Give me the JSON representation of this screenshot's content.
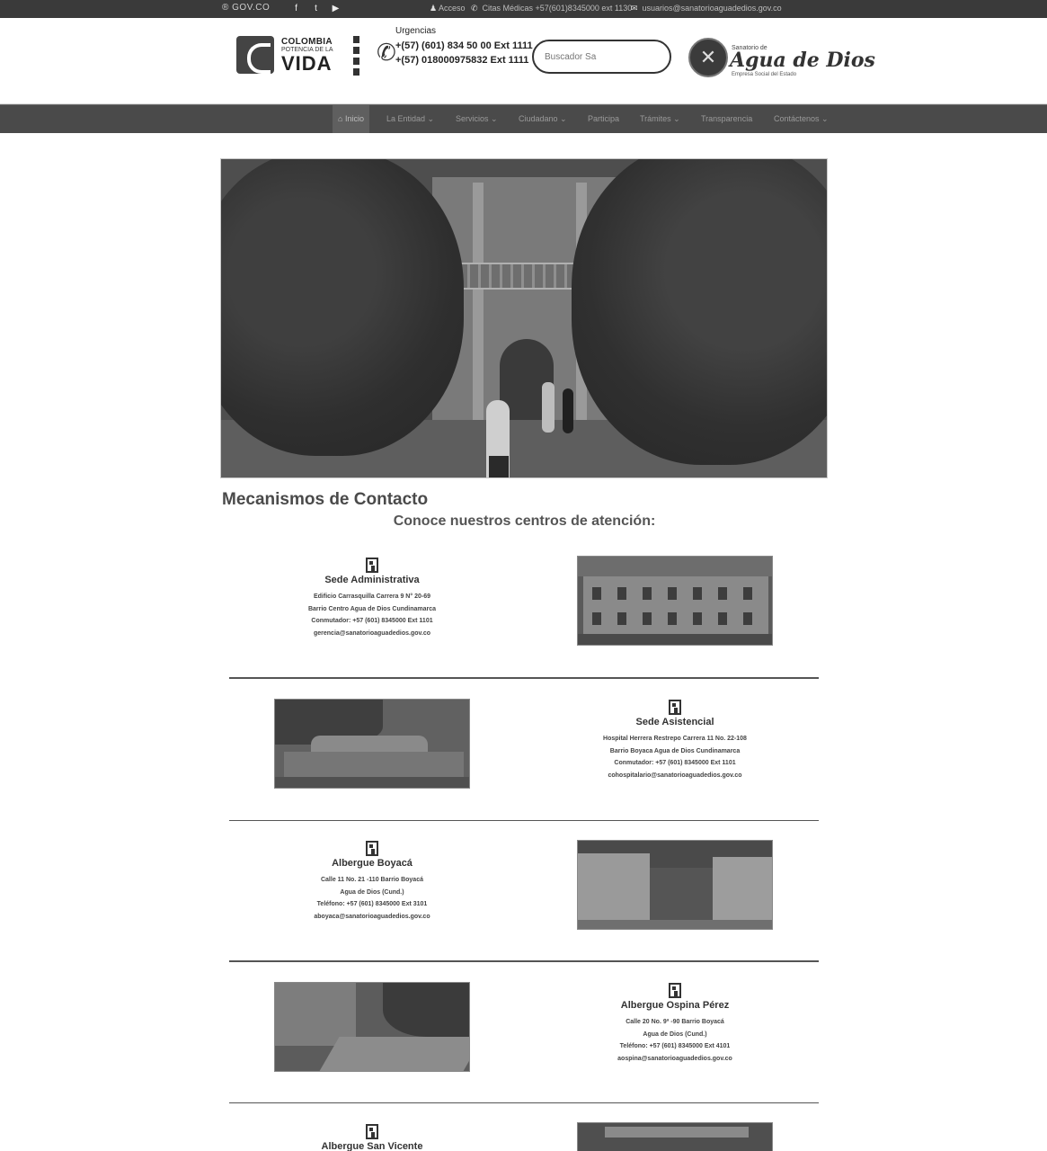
{
  "topbar": {
    "gov_label": "GOV.CO",
    "social": [
      "facebook-icon",
      "twitter-icon",
      "youtube-icon"
    ],
    "access_label": "Acceso",
    "appointments_label": "Citas Médicas +57(601)8345000 ext 1130",
    "email_label": "usuarios@sanatorioaguadedios.gov.co"
  },
  "header": {
    "logo_line1": "COLOMBIA",
    "logo_line2": "POTENCIA DE LA",
    "logo_line3": "VIDA",
    "urgencias_label": "Urgencias",
    "phone1": "+(57) (601) 834 50 00 Ext 1111",
    "phone2": "+(57) 018000975832 Ext 1111",
    "search_placeholder": "Buscador Sa",
    "brand_small": "Sanatorio de",
    "brand_name": "Agua de Dios",
    "brand_sub": "Empresa Social del Estado"
  },
  "nav": {
    "items": [
      {
        "label": "Inicio",
        "active": true
      },
      {
        "label": "La Entidad ⌄",
        "active": false
      },
      {
        "label": "Servicios ⌄",
        "active": false
      },
      {
        "label": "Ciudadano ⌄",
        "active": false
      },
      {
        "label": "Participa",
        "active": false
      },
      {
        "label": "Trámites ⌄",
        "active": false
      },
      {
        "label": "Transparencia",
        "active": false
      },
      {
        "label": "Contáctenos ⌄",
        "active": false
      }
    ]
  },
  "content": {
    "title": "Mecanismos de Contacto",
    "subtitle": "Conoce nuestros centros de atención:",
    "centers": [
      {
        "name": "Sede Administrativa",
        "lines": [
          "Edificio Carrasquilla Carrera 9 N° 20-69",
          "Barrio Centro Agua de Dios Cundinamarca",
          "Conmutador: +57 (601) 8345000 Ext 1101",
          "gerencia@sanatorioaguadedios.gov.co"
        ]
      },
      {
        "name": "Sede Asistencial",
        "lines": [
          "Hospital Herrera Restrepo Carrera 11 No. 22-108",
          "Barrio Boyaca Agua de Dios Cundinamarca",
          "Conmutador: +57 (601) 8345000 Ext 1101",
          "cohospitalario@sanatorioaguadedios.gov.co"
        ]
      },
      {
        "name": "Albergue Boyacá",
        "lines": [
          "Calle 11 No. 21 -110 Barrio Boyacá",
          "Agua de Dios (Cund.)",
          "Teléfono: +57 (601) 8345000 Ext 3101",
          "aboyaca@sanatorioaguadedios.gov.co"
        ]
      },
      {
        "name": "Albergue Ospina Pérez",
        "lines": [
          "Calle 20 No. 9ª -90 Barrio Boyacá",
          "Agua de Dios (Cund.)",
          "Teléfono: +57 (601) 8345000 Ext 4101",
          "aospina@sanatorioaguadedios.gov.co"
        ]
      },
      {
        "name": "Albergue San Vicente",
        "lines": []
      }
    ]
  }
}
